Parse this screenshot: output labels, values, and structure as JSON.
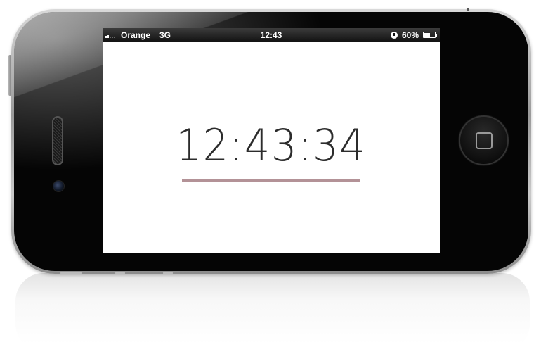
{
  "status_bar": {
    "carrier": "Orange",
    "network": "3G",
    "time": "12:43",
    "battery_percent": "60%",
    "battery_level": 0.6,
    "signal_bars_active": 2,
    "signal_bars_total": 5
  },
  "clock": {
    "time": "12:43:34",
    "underline_color": "#b39297"
  },
  "device": {
    "icons": [
      "home-button-icon",
      "speaker-grille",
      "front-camera-icon",
      "alarm-clock-icon",
      "battery-icon",
      "signal-icon"
    ]
  }
}
